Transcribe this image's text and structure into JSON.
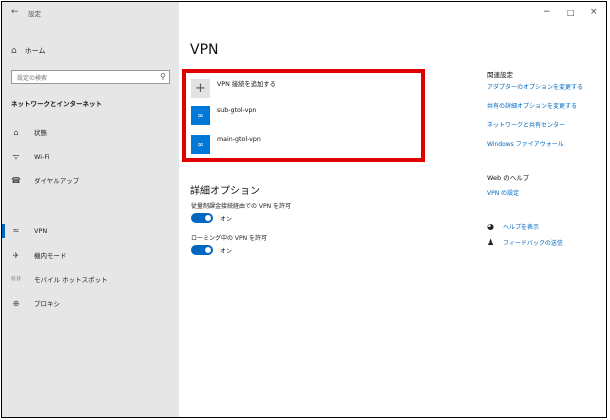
{
  "window": {
    "back_glyph": "←",
    "title": "設定",
    "minimize_glyph": "−",
    "maximize_glyph": "□",
    "close_glyph": "×"
  },
  "sidebar": {
    "home": {
      "icon": "home-icon",
      "glyph": "⌂",
      "label": "ホーム"
    },
    "search_placeholder": "設定の検索",
    "search_glyph": "⚲",
    "section_title": "ネットワークとインターネット",
    "items": [
      {
        "icon": "status-icon",
        "glyph": "⌂",
        "label": "状態"
      },
      {
        "icon": "wifi-icon",
        "glyph": "ᯤ",
        "label": "Wi-Fi"
      },
      {
        "icon": "dialup-icon",
        "glyph": "☎",
        "label": "ダイヤルアップ"
      },
      {
        "icon": "vpn-icon",
        "glyph": "≈",
        "label": "VPN"
      },
      {
        "icon": "airplane-icon",
        "glyph": "✈",
        "label": "機内モード"
      },
      {
        "icon": "hotspot-icon",
        "glyph": "((·))",
        "label": "モバイル ホットスポット"
      },
      {
        "icon": "proxy-icon",
        "glyph": "⊕",
        "label": "プロキシ"
      }
    ]
  },
  "main": {
    "title": "VPN",
    "add_label": "VPN 接続を追加する",
    "add_glyph": "+",
    "connections": [
      {
        "name": "sub-gtol-vpn",
        "glyph": "∞"
      },
      {
        "name": "main-gtol-vpn",
        "glyph": "∞"
      }
    ],
    "advanced_title": "詳細オプション",
    "options": [
      {
        "label": "従量制課金接続経由での VPN を許可",
        "state": "オン"
      },
      {
        "label": "ローミング中の VPN を許可",
        "state": "オン"
      }
    ]
  },
  "related": {
    "heading": "関連設定",
    "links": [
      "アダプターのオプションを変更する",
      "共有の詳細オプションを変更する",
      "ネットワークと共有センター",
      "Windows ファイアウォール"
    ],
    "web_help_heading": "Web のヘルプ",
    "web_help_link": "VPN の設定",
    "help_link": "ヘルプを表示",
    "feedback_link": "フィードバックの送信"
  },
  "colors": {
    "accent": "#0067c0",
    "highlight": "#e00000",
    "sidebar_bg": "#e6e6e6"
  }
}
